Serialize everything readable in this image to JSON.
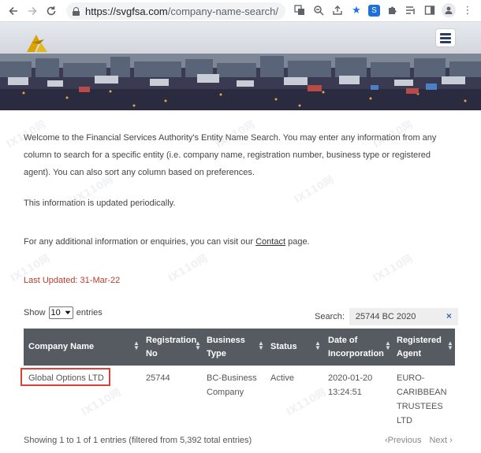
{
  "browser": {
    "url_host": "https://svgfsa.com",
    "url_path": "/company-name-search/",
    "back_icon": "arrow-left-icon",
    "forward_icon": "arrow-right-icon",
    "reload_icon": "reload-icon"
  },
  "site": {
    "logo_icon": "fsa-logo-icon",
    "menu_icon": "hamburger-menu-icon"
  },
  "intro": {
    "line1": "Welcome to the Financial Services Authority's Entity Name Search. You may enter any information from any",
    "line2": "column to search for a specific entity (i.e. company name, registration number, business type or registered",
    "line3": "agent). You can also sort any column based on preferences."
  },
  "updated_note": "This information is updated periodically.",
  "contact": {
    "prefix": "For any additional information or enquiries, you can visit our ",
    "link": "Contact",
    "suffix": " page."
  },
  "last_updated": "Last Updated:  31-Mar-22",
  "controls": {
    "show_label": "Show",
    "entries_value": "10",
    "entries_label": "entries",
    "search_label": "Search:",
    "search_value": "25744 BC 2020",
    "search_clear": "×"
  },
  "table": {
    "headers": [
      {
        "line1": "Company Name",
        "line2": ""
      },
      {
        "line1": "Registration",
        "line2": "No"
      },
      {
        "line1": "Business",
        "line2": "Type"
      },
      {
        "line1": "Status",
        "line2": ""
      },
      {
        "line1": "Date of",
        "line2": "Incorporation"
      },
      {
        "line1": "Registered",
        "line2": "Agent"
      }
    ],
    "row": {
      "company": "Global Options LTD",
      "reg_no": "25744",
      "type_line1": "BC-Business",
      "type_line2": "Company",
      "status": "Active",
      "date_line1": "2020-01-20",
      "date_line2": "13:24:51",
      "agent_line1": "EURO-",
      "agent_line2": "CARIBBEAN",
      "agent_line3": "TRUSTEES",
      "agent_line4": "LTD"
    }
  },
  "footer": {
    "info": "Showing 1 to 1 of 1 entries (filtered from 5,392 total entries)",
    "previous": "Previous",
    "next": "Next"
  },
  "watermark_text": "IX110网",
  "colors": {
    "table_header": "#555b60",
    "last_updated": "#c0392b",
    "highlight_box": "#d9423a"
  }
}
